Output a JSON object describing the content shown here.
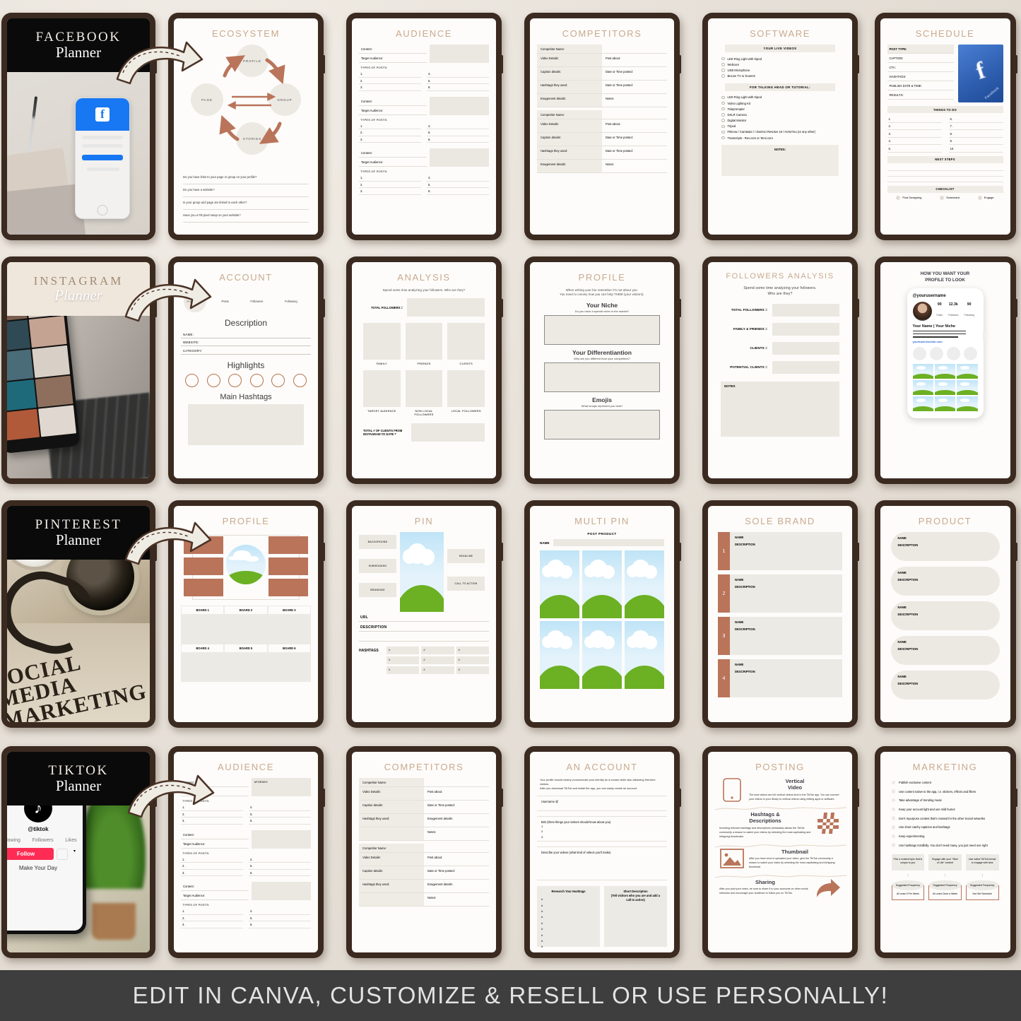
{
  "banner": {
    "text": "EDIT IN CANVA, CUSTOMIZE & RESELL OR USE PERSONALLY!"
  },
  "covers": {
    "facebook": {
      "brand": "FACEBOOK",
      "planner": "Planner"
    },
    "instagram": {
      "brand": "INSTAGRAM",
      "planner": "Planner"
    },
    "pinterest": {
      "brand": "PINTEREST",
      "planner": "Planner"
    },
    "tiktok": {
      "brand": "TIKTOK",
      "planner": "Planner"
    },
    "pinterest_photo_text": [
      "SOCIAL",
      "MEDIA",
      "MARKETING"
    ],
    "tiktok_phone": {
      "app": "TikTok",
      "handle": "@tiktok",
      "stats": [
        "Following",
        "Followers",
        "Likes"
      ],
      "follow": "Follow",
      "tagline": "Make Your Day"
    }
  },
  "facebook": {
    "ecosystem": {
      "title": "ECOSYSTEM",
      "nodes": [
        "PROFILE",
        "PAGE",
        "GROUP",
        "STORIES"
      ],
      "questions": [
        "Do you have links to your page or group on your profile?",
        "Do you have a website?",
        "Is your group and page are linked to each other?",
        "Have you a FB pixel setup on your website?"
      ]
    },
    "audience": {
      "title": "AUDIENCE",
      "fields": [
        "Content:",
        "Target Audience:"
      ],
      "types_label": "TYPES OF POSTS:",
      "items_left": [
        "1.",
        "2.",
        "3."
      ],
      "items_right": [
        "4.",
        "5.",
        "6."
      ],
      "block_count": 3
    },
    "competitors": {
      "title": "COMPETITORS",
      "left_cells": [
        "Competitor Name:",
        "Video Details:",
        "Caption details:",
        "Hashtags they used:",
        "Enagement details:"
      ],
      "right_cells": [
        "",
        "Post about:",
        "Date or Time posted:",
        "Date or Time posted:",
        "Notes:"
      ]
    },
    "software": {
      "title": "SOFTWARE",
      "head1": "YOUR LIVE VIDEOS",
      "list1": [
        "LED Ring Light with tripod",
        "Webcam",
        "USB Microphone",
        "BeLive TV or Ecamm"
      ],
      "head2": "FOR TALKING HEAD OR TUTORIAL:",
      "list2": [
        "LED Ring Light with tripod",
        "Video Lighting Kit",
        "Teleprompter",
        "DSLR Camera",
        "Digital Monitor",
        "Tripod",
        "Filmora / Camtasia / / DaVinci Resolve 16 / AVS4You (or any other)",
        "Transcripts - Rev.com or Temi.com"
      ],
      "notes": "NOTES:"
    },
    "schedule": {
      "title": "SCHEDULE",
      "rows": [
        "POST TYPE:",
        "CAPTION:",
        "CTA:",
        "HASHTAGS:",
        "PUBLISH DATE & TIME:",
        "RESULTS:"
      ],
      "things_to_do": "THINGS TO DO",
      "todo_left": [
        "1.",
        "2.",
        "3.",
        "4.",
        "5."
      ],
      "todo_right": [
        "6.",
        "7.",
        "8.",
        "9.",
        "10."
      ],
      "next_steps": "NEXT STEPS",
      "checklist_label": "CHECKLIST",
      "checklist": [
        "Post Designing",
        "Scheduled",
        "Engage"
      ],
      "image_caption": "Facebook"
    }
  },
  "instagram": {
    "account": {
      "title": "ACCOUNT",
      "profile_photo": "Profile Photo",
      "stats": [
        "Posts",
        "Followers",
        "Following"
      ],
      "description_heading": "Description",
      "fields": [
        "NAME:",
        "WEBSITE:",
        "CATEGORY:"
      ],
      "highlights_heading": "Highlights",
      "highlight_count": 6,
      "hashtags_heading": "Main  Hashtags"
    },
    "analysis": {
      "title": "ANALYSIS",
      "subtitle": "Spend some time analyzing your followers. Who are they?",
      "total_label": "TOTAL FOLLOWERS =",
      "grid_labels": [
        "FAMILY",
        "FRIENDS",
        "CLIENTS",
        "TARGET AUDIENCE",
        "NON LOCAL FOLLOWERS",
        "LOCAL FOLLOWERS"
      ],
      "bottom_label": "TOTAL # OF CLIENTS FROM INSTAGRAM TO DATE ="
    },
    "profile": {
      "title": "PROFILE",
      "subtitle": "When writing your bio remember it's not about you.\nYou need to convey how you can help THEM (your visitors).",
      "sections": [
        {
          "heading": "Your Niche",
          "sub": "Do you have a special niche in the market?"
        },
        {
          "heading": "Your Differentiantion",
          "sub": "Why are you different than your competitors?"
        },
        {
          "heading": "Emojis",
          "sub": "What emojis represent you best?"
        }
      ]
    },
    "followers_analysis": {
      "title": "FOLLOWERS ANALYSIS",
      "subtitle": "Spend some time analyzing your followers.\nWho are they?",
      "rows": [
        "TOTAL FOLLOWERS =",
        "FAMILY & FRIENDS =",
        "CLIENTS =",
        "POTENTIAL CLIENTS ="
      ],
      "notes": "NOTES"
    },
    "mockup": {
      "title": "HOW YOU WANT YOUR\nPROFILE TO LOOK",
      "username": "@yourusername",
      "counts": [
        {
          "value": "90",
          "label": "Posts"
        },
        {
          "value": "12.3k",
          "label": "Followers"
        },
        {
          "value": "90",
          "label": "Following"
        }
      ],
      "name_line": "Your Name | Your Niche",
      "link": "yourbusinesslink.com",
      "highlight_count": 4,
      "grid_count": 9
    }
  },
  "pinterest": {
    "profile": {
      "title": "PROFILE",
      "boards": [
        "BOARD 1",
        "BOARD 2",
        "BOARD 3",
        "BOARD 4",
        "BOARD 5",
        "BOARD 6"
      ]
    },
    "pin": {
      "title": "PIN",
      "left_tags": [
        "BACKGROUND",
        "SUBHEADING",
        "BRANDING"
      ],
      "right_tags": [
        "HEADLINE",
        "CALL TO ACTION"
      ],
      "url_label": "URL",
      "description_label": "DESCRIPTION",
      "hashtags_label": "HASHTAGS",
      "hashtag_cells": [
        "#",
        "#",
        "#",
        "#",
        "#",
        "#",
        "#",
        "#",
        "#"
      ]
    },
    "multi_pin": {
      "title": "MULTI PIN",
      "subtitle": "POST PRODUCT",
      "name_label": "NAME",
      "tile_count": 6
    },
    "sole_brand": {
      "title": "SOLE BRAND",
      "rows": [
        {
          "num": "1",
          "name": "NAME",
          "desc": "DESCRIPTION"
        },
        {
          "num": "2",
          "name": "NAME",
          "desc": "DESCRIPTION"
        },
        {
          "num": "3",
          "name": "NAME",
          "desc": "DESCRIPTION"
        },
        {
          "num": "4",
          "name": "NAME",
          "desc": "DESCRIPTION"
        }
      ]
    },
    "product": {
      "title": "PRODUCT",
      "rows": [
        {
          "name": "NAME",
          "desc": "DESCRIPTION"
        },
        {
          "name": "NAME",
          "desc": "DESCRIPTION"
        },
        {
          "name": "NAME",
          "desc": "DESCRIPTION"
        },
        {
          "name": "NAME",
          "desc": "DESCRIPTION"
        },
        {
          "name": "NAME",
          "desc": "DESCRIPTION"
        }
      ]
    }
  },
  "tiktok": {
    "audience": {
      "title": "AUDIENCE",
      "fields": [
        "Content:",
        "Target Audience:"
      ],
      "first_box_label": "#FOEDEX",
      "types_label": "TYPES OF POSTS:",
      "items_left": [
        "1.",
        "2.",
        "3."
      ],
      "items_right": [
        "4.",
        "5.",
        "6."
      ]
    },
    "competitors": {
      "title": "COMPETITORS",
      "left_cells": [
        "Competitor Name:",
        "Video Details:",
        "Caption details:",
        "Hashtags they used:"
      ],
      "right_cells": [
        "",
        "Post about:",
        "Date or Time posted:",
        "Enagement details:",
        "Notes:"
      ]
    },
    "an_account": {
      "title": "AN ACCOUNT",
      "intro": "Your profile should clearly communicate your identity as a creator while also attracting first-time visitors.\nAfter you download TikTok and install the app, you can easily create an account.",
      "username_label": "Username @",
      "bio_label": "BIO (three things your visitors should know about you)",
      "bio_items": [
        "1",
        "2",
        "3"
      ],
      "videos_label": "Describe your videos (what kind of videos you'll make)",
      "research_title": "Research Your Hashtags",
      "short_title": "Short Description\n(Tell visitors who you are and add a\ncall to action)",
      "hash_count": 11
    },
    "posting": {
      "title": "POSTING",
      "sections": [
        {
          "heading": "Vertical\nVideo",
          "body": "The best videos are full vertical videos shot in the TikTok app. You can convert your videos in your library to vertical videos using editing apps or software.",
          "icon": "phone-icon"
        },
        {
          "heading": "Hashtags &\nDescriptions",
          "body": "Including relevant hashtags and descriptions (metadata) allows the TikTok community a reason to watch your videos by selecting the most captivating and intriguing thumbnails.",
          "icon": "hashtag-icon"
        },
        {
          "heading": "Thumbnail",
          "body": "After you have shot or uploaded your video, give the TikTok community a reason to watch your video by selecting the most captivating and intriguing thumbnail.",
          "icon": "image-icon"
        },
        {
          "heading": "Sharing",
          "body": "After you post your video, be sure to share it to your accounts on other social networks and encourage your audience to follow you on TikTok.",
          "icon": "share-arrow-icon"
        }
      ]
    },
    "marketing": {
      "title": "MARKETING",
      "items": [
        "Publish exclusive content",
        "Use content native to the app, i.e. stickers, effects and filters",
        "Take advantage of trending music",
        "Keep your account light and use mild humor",
        "Don't repurpose content that's created for the other Social networks",
        "Use short catchy captions and hashtags",
        "Keep experimenting",
        "Use hashtags mindfully. You don't need many, you just need one right"
      ],
      "flow": [
        {
          "top": "Pick a content topic that is unique to you",
          "mid": "Suggested Frequency",
          "bottom": "At Least 3 Per Week"
        },
        {
          "top": "Engage with your \"Slice of Life\" content",
          "mid": "Suggested Frequency",
          "bottom": "At Least Once a Week"
        },
        {
          "top": "Use native TikTok format to engage with fans",
          "mid": "Suggested Frequency",
          "bottom": "Not Set Schedule"
        }
      ]
    }
  }
}
